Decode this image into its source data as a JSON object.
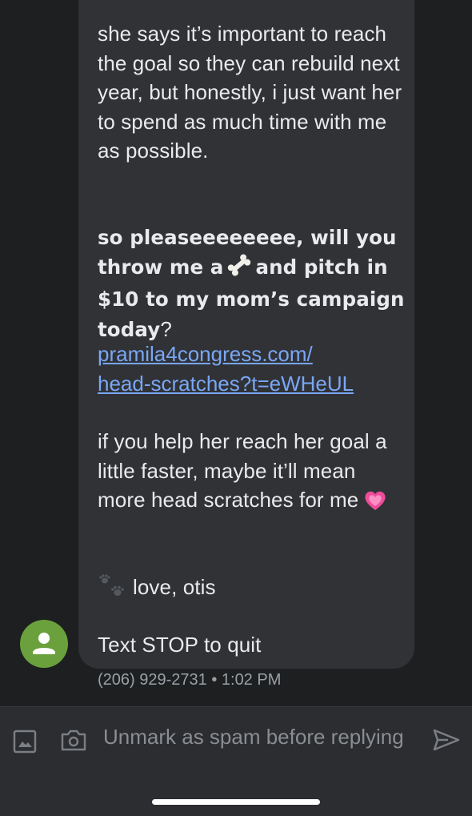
{
  "message": {
    "paragraph1": "she says it’s important to reach the goal so they can rebuild next year, but honestly, i just want her to spend as much time with me as possible.",
    "bold_part1": "so pleaseeeeeeee, will you throw me a",
    "bone_emoji": "bone-emoji",
    "bold_part2": "and pitch in $10 to my mom’s campaign today",
    "question_mark": "?",
    "link_line1": "pramila4congress.com/",
    "link_line2": "head-scratches?t=eWHeUL",
    "paragraph3": "if you help her reach her goal a little faster, maybe it’ll mean more head scratches for me",
    "heart_emoji": "heart-emoji",
    "paw_emoji": "paw-prints-emoji",
    "signoff": "love, otis",
    "stop_text": "Text STOP to quit"
  },
  "meta": {
    "sender_time": "(206) 929-2731 • 1:02 PM"
  },
  "composer": {
    "placeholder": "Unmark as spam before replying",
    "gallery_icon": "gallery-icon",
    "camera_icon": "camera-icon",
    "send_icon": "send-icon"
  },
  "colors": {
    "background": "#1d1f21",
    "bubble": "#303236",
    "link": "#7aa7f5",
    "avatar": "#6aa13c"
  }
}
